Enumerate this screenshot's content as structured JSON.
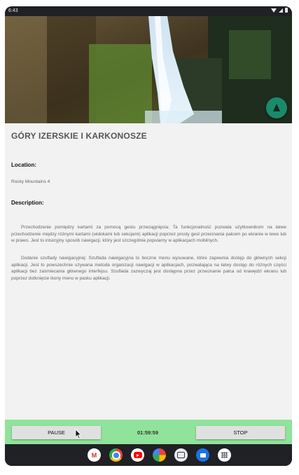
{
  "status_bar": {
    "time": "6:43"
  },
  "place": {
    "title": "GÓRY IZERSKIE I KARKONOSZE",
    "location_label": "Location:",
    "location_value": "Rocky Mountains 4",
    "description_label": "Description:",
    "paragraphs": [
      "Przechodzenie pomiędzy kartami za pomocą gestu przeciągnięcia: Ta funkcjonalność pozwala użytkownikom na łatwe przechodzenie między różnymi kartami (widokami lub sekcjami) aplikacji poprzez prosty gest przecinania palcem po ekranie w lewo lub w prawo. Jest to intuicyjny sposób nawigacji, który jest szczególnie popularny w aplikacjach mobilnych.",
      "Dodanie szuflady nawigacyjnej: Szuflada nawigacyjna to boczne menu wysuwane, które zapewnia dostęp do głównych sekcji aplikacji. Jest to powszechnie używana metoda organizacji nawigacji w aplikacjach, pozwalająca na łatwy dostęp do różnych części aplikacji bez zaśmiecania głównego interfejsu. Szuflada zazwyczaj jest dostępna przez przecinanie palca od krawędzi ekranu lub poprzez dotknięcie ikony menu w pasku aplikacji."
    ]
  },
  "controls": {
    "pause_label": "PAUSE",
    "timer": "01:59:59",
    "stop_label": "STOP"
  },
  "fab": {
    "icon": "navigation-arrow-icon"
  },
  "dock": {
    "apps": [
      "gmail-icon",
      "chrome-icon",
      "youtube-icon",
      "photos-icon",
      "camera-icon",
      "messages-icon",
      "app-drawer-icon"
    ]
  },
  "colors": {
    "controls_bar": "#90e39b",
    "fab": "#1a8a6a",
    "background": "#f2f2f2"
  }
}
